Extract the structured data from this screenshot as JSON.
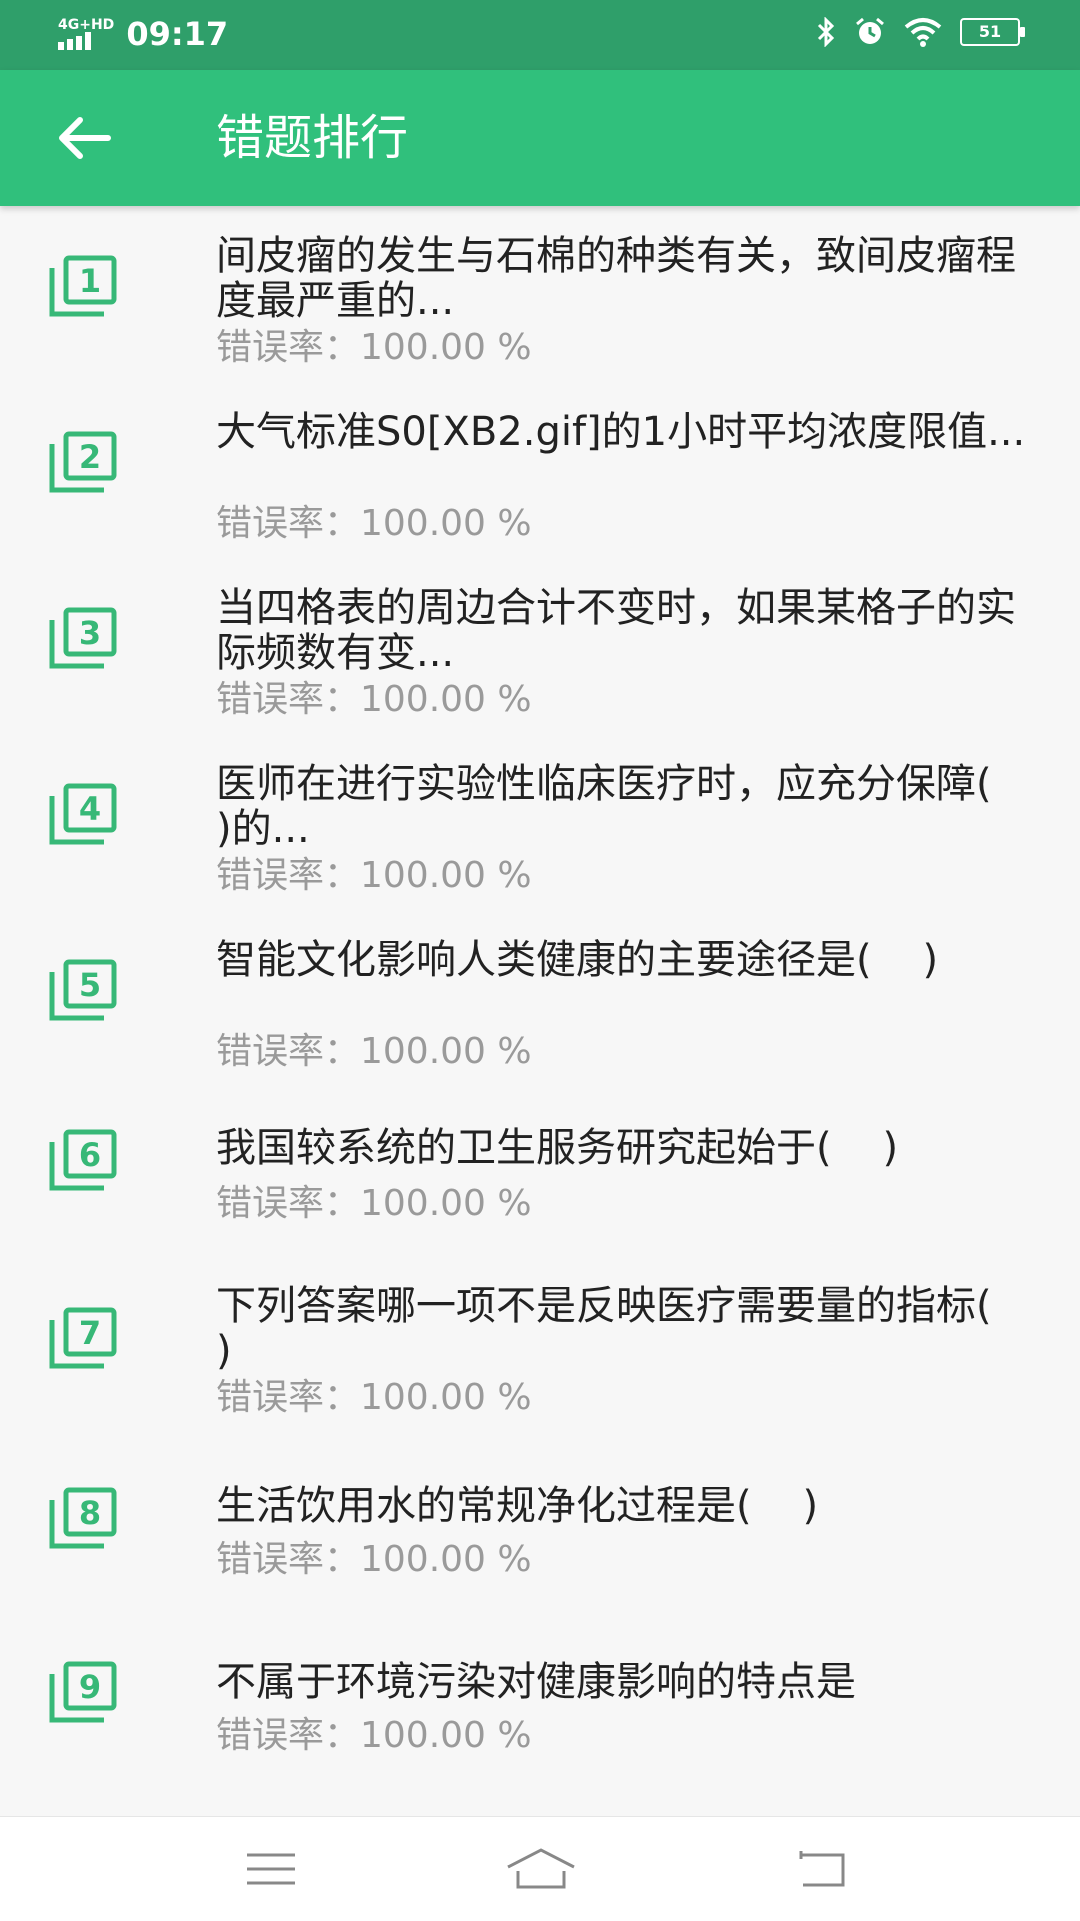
{
  "status_bar": {
    "network": "4G+HD",
    "time": "09:17",
    "battery": "51",
    "icons": [
      "bluetooth-icon",
      "alarm-icon",
      "wifi-icon",
      "battery-icon"
    ]
  },
  "app_bar": {
    "title": "错题排行",
    "back_icon": "back-arrow-icon"
  },
  "colors": {
    "status_bar": "#2f9f6a",
    "app_bar": "#30c07c",
    "rank_icon": "#37b877",
    "error_text": "#9a9a9a"
  },
  "items": [
    {
      "rank": "1",
      "question": "间皮瘤的发生与石棉的种类有关，致间皮瘤程度最严重的...",
      "error_rate": "错误率：100.00 %"
    },
    {
      "rank": "2",
      "question": "大气标准S0[XB2.gif]的1小时平均浓度限值...",
      "error_rate": "错误率：100.00 %"
    },
    {
      "rank": "3",
      "question": "当四格表的周边合计不变时，如果某格子的实际频数有变...",
      "error_rate": "错误率：100.00 %"
    },
    {
      "rank": "4",
      "question": "医师在进行实验性临床医疗时，应充分保障(    )的...",
      "error_rate": "错误率：100.00 %"
    },
    {
      "rank": "5",
      "question": "智能文化影响人类健康的主要途径是(    )",
      "error_rate": "错误率：100.00 %"
    },
    {
      "rank": "6",
      "question": "我国较系统的卫生服务研究起始于(    )",
      "error_rate": "错误率：100.00 %"
    },
    {
      "rank": "7",
      "question": "下列答案哪一项不是反映医疗需要量的指标(    )",
      "error_rate": "错误率：100.00 %"
    },
    {
      "rank": "8",
      "question": "生活饮用水的常规净化过程是(    )",
      "error_rate": "错误率：100.00 %"
    },
    {
      "rank": "9",
      "question": "不属于环境污染对健康影响的特点是",
      "error_rate": "错误率：100.00 %"
    }
  ],
  "nav_bar": {
    "buttons": [
      "menu-icon",
      "home-icon",
      "back-icon"
    ]
  }
}
